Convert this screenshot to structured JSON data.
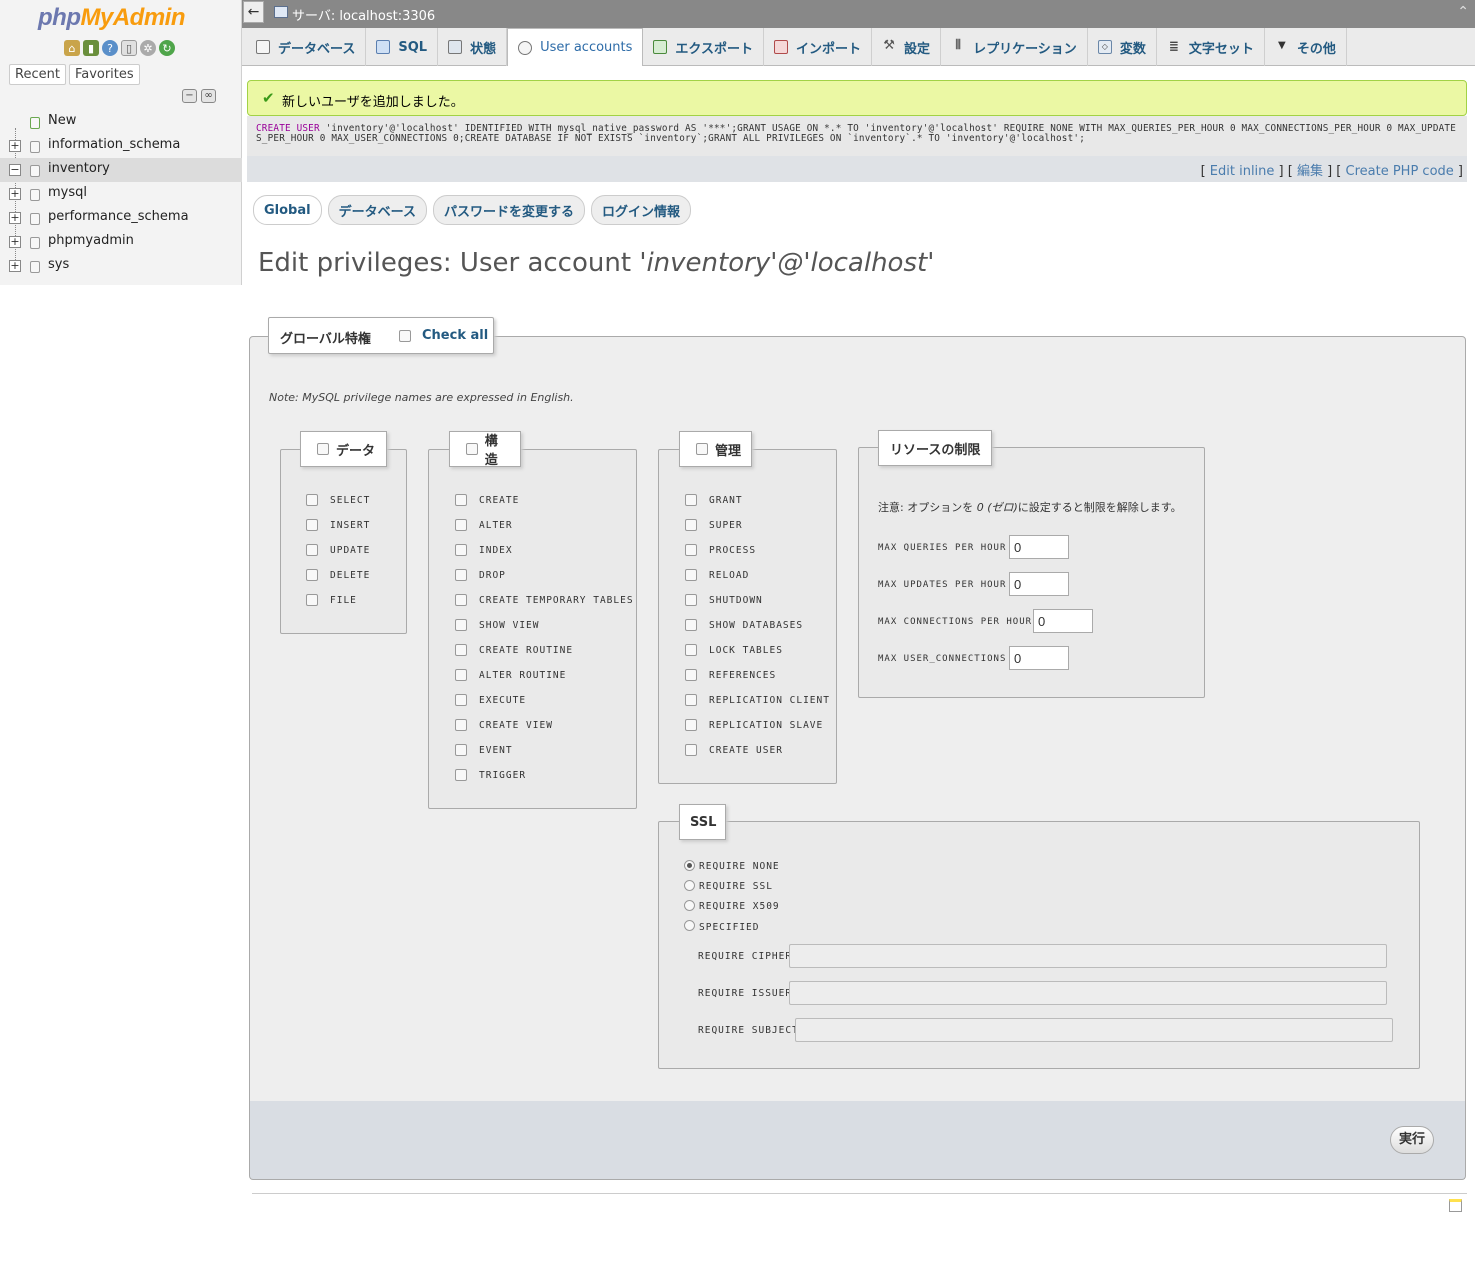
{
  "sidebar": {
    "logo_php": "php",
    "logo_myadmin": "MyAdmin",
    "logo_icons": [
      "home-icon",
      "exit-icon",
      "help-icon",
      "docs-icon",
      "settings-icon",
      "reload-icon"
    ],
    "recent_label": "Recent",
    "favorites_label": "Favorites",
    "tree": [
      {
        "label": "New",
        "expandable": false,
        "selected": false
      },
      {
        "label": "information_schema",
        "expandable": true,
        "selected": false
      },
      {
        "label": "inventory",
        "expandable": true,
        "selected": true
      },
      {
        "label": "mysql",
        "expandable": true,
        "selected": false
      },
      {
        "label": "performance_schema",
        "expandable": true,
        "selected": false
      },
      {
        "label": "phpmyadmin",
        "expandable": true,
        "selected": false
      },
      {
        "label": "sys",
        "expandable": true,
        "selected": false
      }
    ]
  },
  "topbar": {
    "back_label": "←",
    "server_label": "サーバ: localhost:3306"
  },
  "tabs": [
    {
      "label": "データベース",
      "icon": "database-icon",
      "active": false
    },
    {
      "label": "SQL",
      "icon": "sql-icon",
      "active": false
    },
    {
      "label": "状態",
      "icon": "status-icon",
      "active": false
    },
    {
      "label": "User accounts",
      "icon": "users-icon",
      "active": true
    },
    {
      "label": "エクスポート",
      "icon": "export-icon",
      "active": false
    },
    {
      "label": "インポート",
      "icon": "import-icon",
      "active": false
    },
    {
      "label": "設定",
      "icon": "wrench-icon",
      "active": false
    },
    {
      "label": "レプリケーション",
      "icon": "replication-icon",
      "active": false
    },
    {
      "label": "変数",
      "icon": "variables-icon",
      "active": false
    },
    {
      "label": "文字セット",
      "icon": "charset-icon",
      "active": false
    },
    {
      "label": "その他",
      "icon": "chevron-down-icon",
      "active": false
    }
  ],
  "success_message": "新しいユーザを追加しました。",
  "sql": {
    "keyword": "CREATE USER",
    "rest": " 'inventory'@'localhost' IDENTIFIED WITH mysql_native_password AS '***';GRANT USAGE ON *.* TO 'inventory'@'localhost' REQUIRE NONE WITH MAX_QUERIES_PER_HOUR 0 MAX_CONNECTIONS_PER_HOUR 0 MAX_UPDATES_PER_HOUR 0 MAX_USER_CONNECTIONS 0;CREATE DATABASE IF NOT EXISTS `inventory`;GRANT ALL PRIVILEGES ON `inventory`.* TO 'inventory'@'localhost';",
    "edit_inline": "Edit inline",
    "edit": "編集",
    "create_php": "Create PHP code"
  },
  "subtabs": [
    {
      "label": "Global",
      "active": true
    },
    {
      "label": "データベース",
      "active": false
    },
    {
      "label": "パスワードを変更する",
      "active": false
    },
    {
      "label": "ログイン情報",
      "active": false
    }
  ],
  "heading": {
    "prefix": "Edit privileges: User account ",
    "account": "'inventory'@'localhost'"
  },
  "global_privs": {
    "legend": "グローバル特権",
    "check_all": "Check all",
    "note": "Note: MySQL privilege names are expressed in English.",
    "data_group": {
      "legend": "データ",
      "items": [
        "SELECT",
        "INSERT",
        "UPDATE",
        "DELETE",
        "FILE"
      ]
    },
    "structure_group": {
      "legend": "構造",
      "items": [
        "CREATE",
        "ALTER",
        "INDEX",
        "DROP",
        "CREATE TEMPORARY TABLES",
        "SHOW VIEW",
        "CREATE ROUTINE",
        "ALTER ROUTINE",
        "EXECUTE",
        "CREATE VIEW",
        "EVENT",
        "TRIGGER"
      ]
    },
    "admin_group": {
      "legend": "管理",
      "items": [
        "GRANT",
        "SUPER",
        "PROCESS",
        "RELOAD",
        "SHUTDOWN",
        "SHOW DATABASES",
        "LOCK TABLES",
        "REFERENCES",
        "REPLICATION CLIENT",
        "REPLICATION SLAVE",
        "CREATE USER"
      ]
    }
  },
  "resource_limits": {
    "legend": "リソースの制限",
    "note_prefix": "注意: オプションを ",
    "note_zero": "0 (ゼロ)",
    "note_suffix": "に設定すると制限を解除します。",
    "max_queries_label": "MAX QUERIES PER HOUR",
    "max_queries_value": "0",
    "max_updates_label": "MAX UPDATES PER HOUR",
    "max_updates_value": "0",
    "max_connections_label": "MAX CONNECTIONS PER HOUR",
    "max_connections_value": "0",
    "max_user_connections_label": "MAX USER_CONNECTIONS",
    "max_user_connections_value": "0"
  },
  "ssl": {
    "legend": "SSL",
    "options": [
      "REQUIRE NONE",
      "REQUIRE SSL",
      "REQUIRE X509",
      "SPECIFIED"
    ],
    "selected_option": "REQUIRE NONE",
    "cipher_label": "REQUIRE CIPHER",
    "issuer_label": "REQUIRE ISSUER",
    "subject_label": "REQUIRE SUBJECT"
  },
  "execute_label": "実行"
}
